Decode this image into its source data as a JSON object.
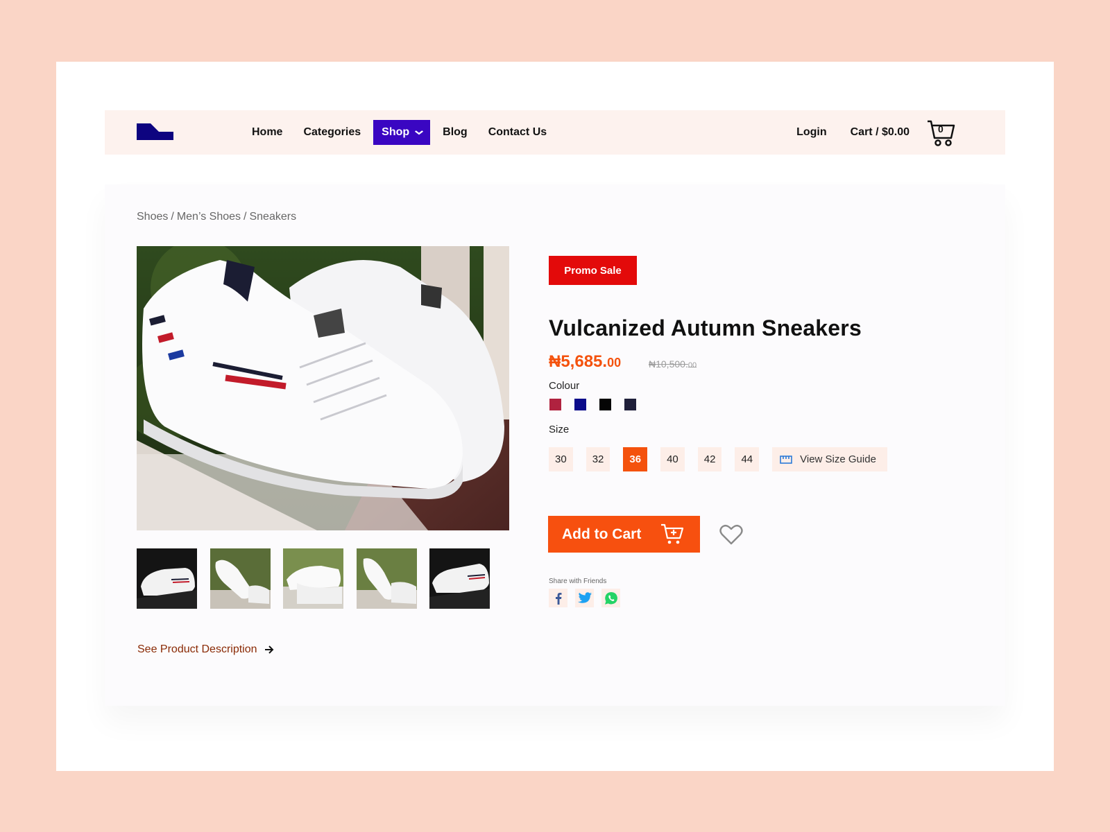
{
  "nav": {
    "menu": [
      {
        "label": "Home",
        "active": false
      },
      {
        "label": "Categories",
        "active": false
      },
      {
        "label": "Shop",
        "active": true
      },
      {
        "label": "Blog",
        "active": false
      },
      {
        "label": "Contact Us",
        "active": false
      }
    ],
    "login": "Login",
    "cart_total": "Cart / $0.00",
    "cart_count": "0"
  },
  "breadcrumb": [
    "Shoes",
    "Men’s Shoes",
    "Sneakers"
  ],
  "breadcrumb_sep": "/",
  "product": {
    "badge": "Promo Sale",
    "title": "Vulcanized Autumn Sneakers",
    "price_main": "₦5,685.",
    "price_cents": "00",
    "old_price_main": "₦10,500.",
    "old_price_cents": "00",
    "colour_label": "Colour",
    "colours": [
      "#b0223f",
      "#0b0b8a",
      "#050505",
      "#1f1f3a"
    ],
    "size_label": "Size",
    "sizes": [
      "30",
      "32",
      "36",
      "40",
      "42",
      "44"
    ],
    "selected_size": "36",
    "size_guide": "View Size Guide",
    "add_to_cart": "Add to Cart",
    "share_label": "Share with Friends",
    "description_link": "See Product Description"
  },
  "colors": {
    "accent": "#f7500f",
    "brand": "#3a06c2",
    "promo": "#e30a0a"
  }
}
